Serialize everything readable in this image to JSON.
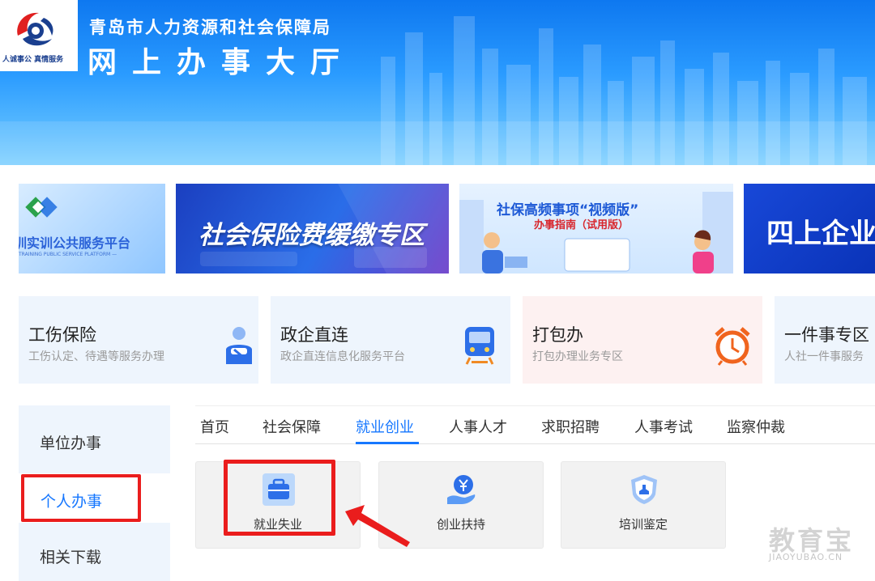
{
  "header": {
    "logo_slogan": "人诚事公 真情服务",
    "org_name": "青岛市人力资源和社会保障局",
    "hall_name": "网上办事大厅"
  },
  "banners": [
    {
      "title": "训实训公共服务平台",
      "sub": "TRAINING PUBLIC SERVICE PLATFORM —"
    },
    {
      "title": "社会保险费缓缴专区"
    },
    {
      "title": "社保高频事项“视频版”",
      "sub": "办事指南（试用版）"
    },
    {
      "title": "四上企业"
    }
  ],
  "services": [
    {
      "title": "工伤保险",
      "desc": "工伤认定、待遇等服务办理"
    },
    {
      "title": "政企直连",
      "desc": "政企直连信息化服务平台"
    },
    {
      "title": "打包办",
      "desc": "打包办理业务专区"
    },
    {
      "title": "一件事专区",
      "desc": "人社一件事服务"
    }
  ],
  "sidebar": {
    "items": [
      {
        "label": "单位办事"
      },
      {
        "label": "个人办事"
      },
      {
        "label": "相关下载"
      }
    ]
  },
  "tabs": [
    {
      "label": "首页"
    },
    {
      "label": "社会保障"
    },
    {
      "label": "就业创业"
    },
    {
      "label": "人事人才"
    },
    {
      "label": "求职招聘"
    },
    {
      "label": "人事考试"
    },
    {
      "label": "监察仲裁"
    }
  ],
  "active_tab": "就业创业",
  "tiles": [
    {
      "label": "就业失业"
    },
    {
      "label": "创业扶持"
    },
    {
      "label": "培训鉴定"
    }
  ],
  "watermark": {
    "main": "教育宝",
    "sub": "JIAOYUBAO.CN"
  },
  "colors": {
    "accent": "#1677ff",
    "highlight": "#ea1d1d",
    "header_blue": "#1a86f5"
  }
}
